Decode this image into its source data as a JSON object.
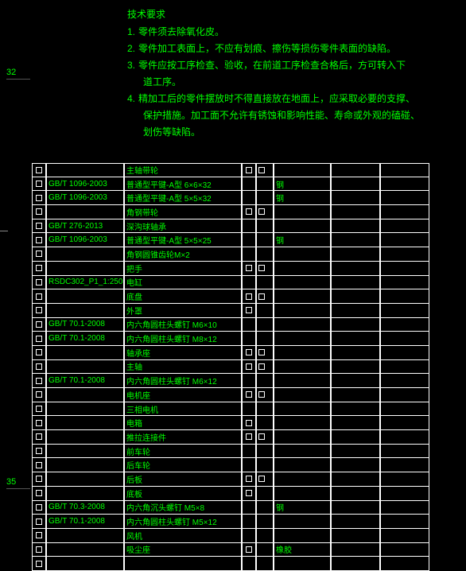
{
  "annotations": {
    "a32": "32",
    "a35": "35"
  },
  "notes": {
    "title": "技术要求",
    "items": [
      {
        "num": "1.",
        "text": "零件须去除氧化皮。"
      },
      {
        "num": "2.",
        "text": "零件加工表面上，不应有划痕、擦伤等损伤零件表面的缺陷。"
      },
      {
        "num": "3.",
        "text": "零件应按工序检查、验收，在前道工序检查合格后，方可转入下"
      },
      {
        "num": "",
        "text": "道工序。",
        "indent": true
      },
      {
        "num": "4.",
        "text": "精加工后的零件摆放时不得直接放在地面上，应采取必要的支撑、"
      },
      {
        "num": "",
        "text": "保护措施。加工面不允许有锈蚀和影响性能、寿命或外观的磕碰、",
        "indent": true
      },
      {
        "num": "",
        "text": "划伤等缺陷。",
        "indent": true
      }
    ]
  },
  "rows": [
    {
      "std": "",
      "desc": "主轴带轮",
      "m1": true,
      "m2": true,
      "mat": ""
    },
    {
      "std": "GB/T 1096-2003",
      "desc": "普通型平键-A型 6×6×32",
      "m1": "",
      "m2": "",
      "mat": "钢"
    },
    {
      "std": "GB/T 1096-2003",
      "desc": "普通型平键-A型 5×5×32",
      "m1": "",
      "m2": "",
      "mat": "钢"
    },
    {
      "std": "",
      "desc": "角钢带轮",
      "m1": true,
      "m2": true,
      "mat": ""
    },
    {
      "std": "GB/T 276-2013",
      "desc": "深沟球轴承",
      "m1": "",
      "m2": "",
      "mat": ""
    },
    {
      "std": "GB/T 1096-2003",
      "desc": "普通型平键-A型 5×5×25",
      "m1": "",
      "m2": "",
      "mat": "钢"
    },
    {
      "std": "",
      "desc": "角钢圆锥齿轮M×2",
      "m1": "",
      "m2": "",
      "mat": ""
    },
    {
      "std": "",
      "desc": "把手",
      "m1": true,
      "m2": true,
      "mat": ""
    },
    {
      "std": "RSDC302_P1_1:250",
      "desc": "电缸",
      "m1": "",
      "m2": "",
      "mat": ""
    },
    {
      "std": "",
      "desc": "底盘",
      "m1": true,
      "m2": true,
      "mat": ""
    },
    {
      "std": "",
      "desc": "外罩",
      "m1": true,
      "m2": "",
      "mat": ""
    },
    {
      "std": "GB/T 70.1-2008",
      "desc": "内六角圆柱头螺钉 M6×10",
      "m1": "",
      "m2": "",
      "mat": ""
    },
    {
      "std": "GB/T 70.1-2008",
      "desc": "内六角圆柱头螺钉 M8×12",
      "m1": "",
      "m2": "",
      "mat": ""
    },
    {
      "std": "",
      "desc": "轴承座",
      "m1": true,
      "m2": true,
      "mat": ""
    },
    {
      "std": "",
      "desc": "主轴",
      "m1": true,
      "m2": true,
      "mat": ""
    },
    {
      "std": "GB/T 70.1-2008",
      "desc": "内六角圆柱头螺钉 M6×12",
      "m1": "",
      "m2": "",
      "mat": ""
    },
    {
      "std": "",
      "desc": "电机座",
      "m1": true,
      "m2": true,
      "mat": ""
    },
    {
      "std": "",
      "desc": "三相电机",
      "m1": "",
      "m2": "",
      "mat": ""
    },
    {
      "std": "",
      "desc": "电箱",
      "m1": true,
      "m2": "",
      "mat": ""
    },
    {
      "std": "",
      "desc": "推拉连接件",
      "m1": true,
      "m2": true,
      "mat": ""
    },
    {
      "std": "",
      "desc": "前车轮",
      "m1": "",
      "m2": "",
      "mat": ""
    },
    {
      "std": "",
      "desc": "后车轮",
      "m1": "",
      "m2": "",
      "mat": ""
    },
    {
      "std": "",
      "desc": "后板",
      "m1": true,
      "m2": true,
      "mat": ""
    },
    {
      "std": "",
      "desc": "底板",
      "m1": true,
      "m2": "",
      "mat": ""
    },
    {
      "std": "GB/T 70.3-2008",
      "desc": "内六角沉头螺钉 M5×8",
      "m1": "",
      "m2": "",
      "mat": "钢"
    },
    {
      "std": "GB/T 70.1-2008",
      "desc": "内六角圆柱头螺钉 M5×12",
      "m1": "",
      "m2": "",
      "mat": ""
    },
    {
      "std": "",
      "desc": "风机",
      "m1": "",
      "m2": "",
      "mat": ""
    },
    {
      "std": "",
      "desc": "吸尘座",
      "m1": true,
      "m2": "",
      "mat": "橡胶"
    },
    {
      "std": "",
      "desc": "",
      "m1": "",
      "m2": "",
      "mat": ""
    }
  ]
}
